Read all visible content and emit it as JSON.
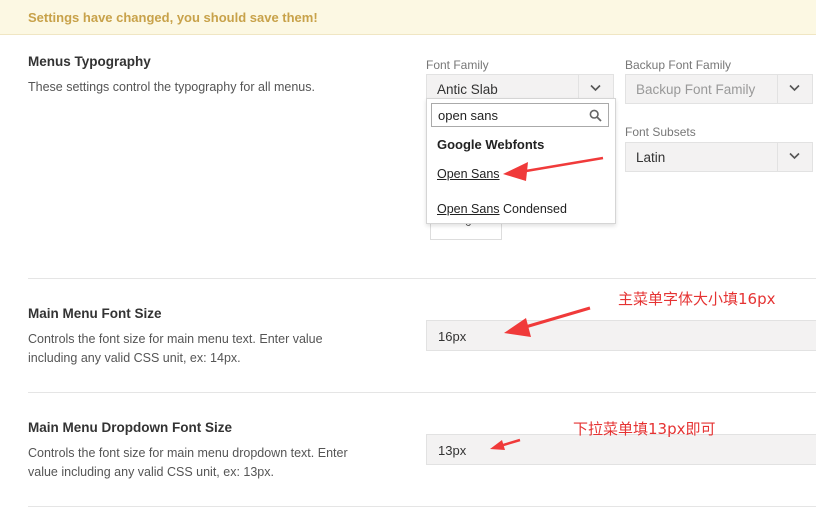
{
  "notice": {
    "text": "Settings have changed, you should save them!"
  },
  "menus_typography": {
    "title": "Menus Typography",
    "description": "These settings control the typography for all menus.",
    "font_family": {
      "label": "Font Family",
      "value": "Antic Slab"
    },
    "backup_font_family": {
      "label": "Backup Font Family",
      "placeholder": "Backup Font Family"
    },
    "font_subsets": {
      "label": "Font Subsets",
      "value": "Latin"
    },
    "dropdown": {
      "search_value": "open sans",
      "group": "Google Webfonts",
      "options": [
        {
          "match": "Open Sans",
          "rest": ""
        },
        {
          "match": "Open Sans",
          "rest": " Condensed"
        }
      ]
    },
    "hidden_field_value": "0"
  },
  "main_menu_font_size": {
    "title": "Main Menu Font Size",
    "description_line1": "Controls the font size for main menu text. Enter value",
    "description_line2": "including any valid CSS unit, ex: 14px.",
    "value": "16px",
    "annotation": "主菜单字体大小填16px"
  },
  "main_menu_dropdown_font_size": {
    "title": "Main Menu Dropdown Font Size",
    "description_line1": "Controls the font size for main menu dropdown text. Enter",
    "description_line2": "value including any valid CSS unit, ex: 13px.",
    "value": "13px",
    "annotation": "下拉菜单填13px即可"
  },
  "colors": {
    "annotation": "#e53333",
    "notice_text": "#c8a24a"
  }
}
